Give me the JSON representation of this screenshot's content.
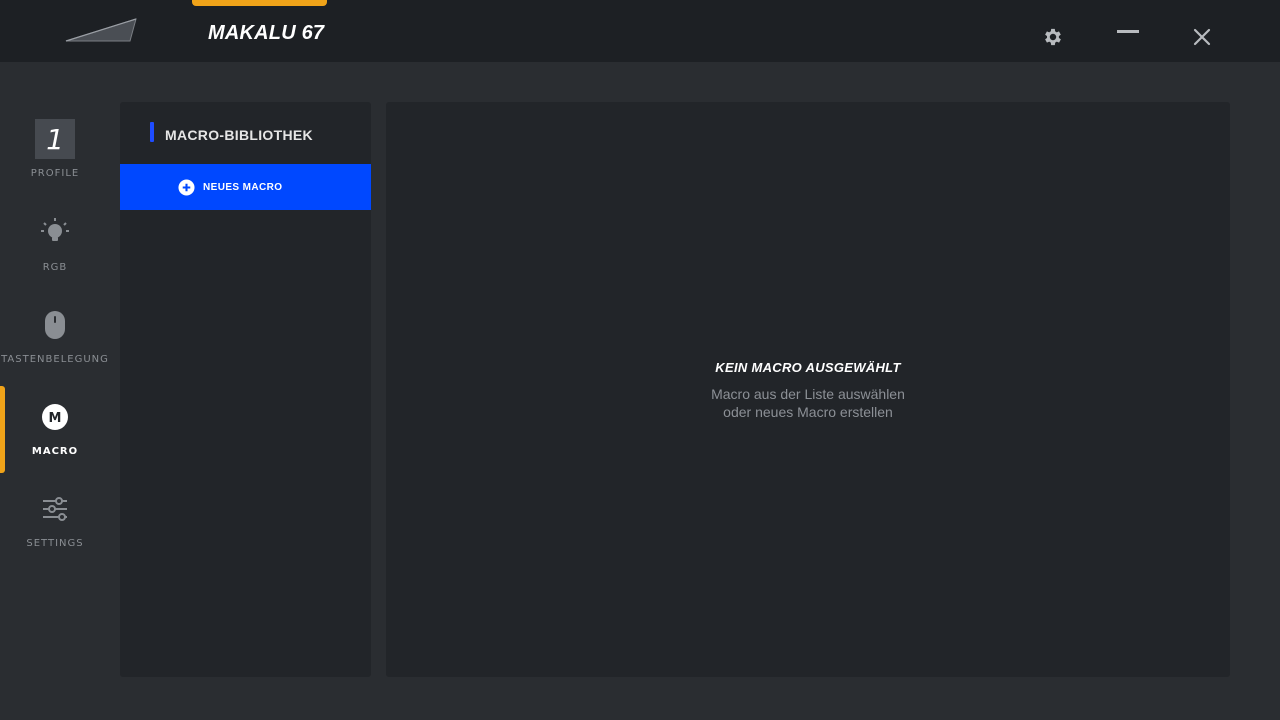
{
  "app": {
    "title": "MAKALU 67",
    "accent_color": "#f0a319"
  },
  "window_controls": {
    "settings_icon": "gear-icon",
    "minimize_icon": "minimize-icon",
    "close_icon": "close-icon"
  },
  "nav": {
    "items": [
      {
        "label": "PROFILE",
        "icon": "profile-number",
        "badge": "1"
      },
      {
        "label": "RGB",
        "icon": "lightbulb-icon"
      },
      {
        "label": "TASTENBELEGUNG",
        "icon": "mouse-icon"
      },
      {
        "label": "MACRO",
        "icon": "macro-icon",
        "badge": "M",
        "active": true
      },
      {
        "label": "SETTINGS",
        "icon": "sliders-icon"
      }
    ]
  },
  "library": {
    "header": "MACRO-BIBLIOTHEK",
    "header_accent": "#1e4cff",
    "new_button_label": "NEUES MACRO",
    "new_button_color": "#0048ff"
  },
  "main": {
    "empty_title": "KEIN MACRO AUSGEWÄHLT",
    "empty_line1": "Macro aus der Liste auswählen",
    "empty_line2": "oder neues Macro erstellen"
  }
}
